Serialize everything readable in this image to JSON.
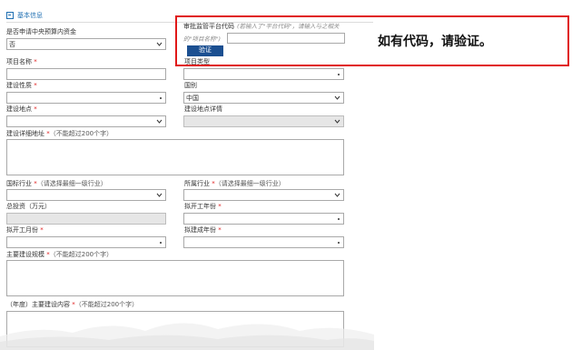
{
  "section": {
    "title": "基本信息"
  },
  "fields": {
    "central_budget": {
      "label": "是否申请中央预算内资金",
      "value": "否"
    },
    "audit_code": {
      "label": "审批监管平台代码",
      "hint_line1": "(若输入了\"平台代码\"，请输入与之相关",
      "hint_line2": "的\"项目名称\")",
      "verify_label": "验证"
    },
    "project_name": {
      "label": "项目名称",
      "required": "*"
    },
    "project_type": {
      "label": "项目类型",
      "required": "*"
    },
    "construction_nature": {
      "label": "建设性质",
      "required": "*"
    },
    "country": {
      "label": "国别",
      "value": "中国"
    },
    "construction_site": {
      "label": "建设地点",
      "required": "*"
    },
    "site_detail": {
      "label": "建设地点详情"
    },
    "detail_address": {
      "label": "建设详细地址",
      "required": "*",
      "note": "（不能超过200个字）"
    },
    "national_industry": {
      "label": "国标行业",
      "required": "*",
      "note": "（请选择最细一级行业）"
    },
    "belonging_industry": {
      "label": "所属行业",
      "required": "*",
      "note": "（请选择最细一级行业）"
    },
    "total_investment": {
      "label": "总投资（万元）"
    },
    "planned_start_year": {
      "label": "拟开工年份",
      "required": "*"
    },
    "planned_start_month": {
      "label": "拟开工月份",
      "required": "*"
    },
    "planned_completion_year": {
      "label": "拟建成年份",
      "required": "*"
    },
    "main_scale": {
      "label": "主要建设规模",
      "required": "*",
      "note": "（不能超过200个字）"
    },
    "annual_content": {
      "label_prefix": "（年度）主要建设内容",
      "required": "*",
      "note": "（不能超过200个字）"
    }
  },
  "callout": {
    "text": "如有代码，请验证。"
  },
  "colors": {
    "accent": "#1f6fb2",
    "button": "#1b4f91",
    "highlight": "#e01818",
    "required": "#e02020"
  }
}
